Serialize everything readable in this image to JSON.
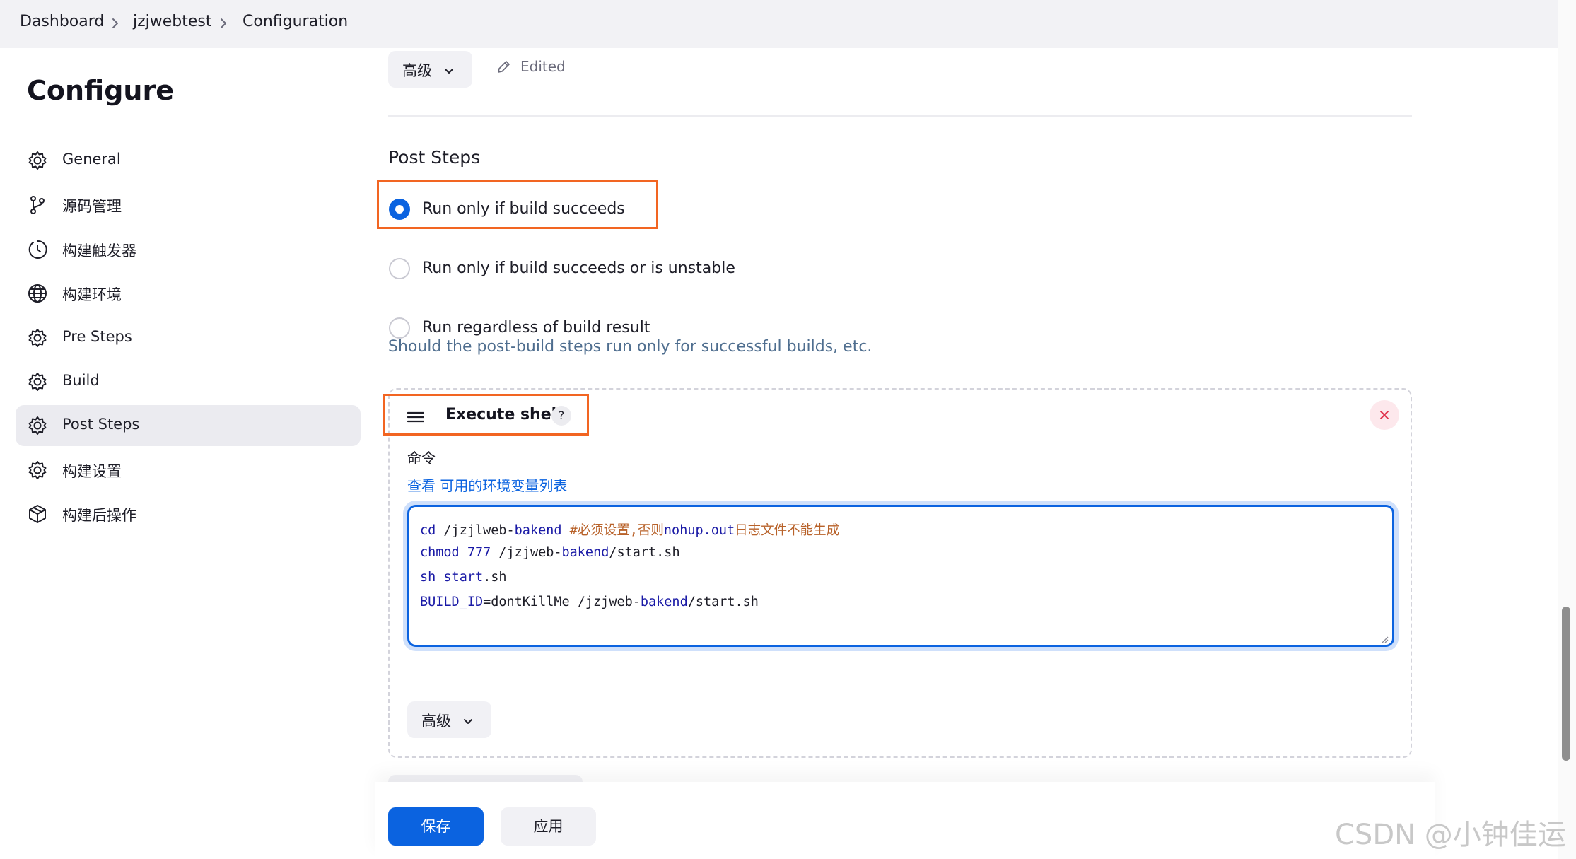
{
  "breadcrumb": {
    "items": [
      "Dashboard",
      "jzjwebtest",
      "Configuration"
    ]
  },
  "sidebar": {
    "title": "Configure",
    "items": [
      {
        "label": "General",
        "icon": "gear-icon"
      },
      {
        "label": "源码管理",
        "icon": "git-branch-icon"
      },
      {
        "label": "构建触发器",
        "icon": "clock-icon"
      },
      {
        "label": "构建环境",
        "icon": "globe-icon"
      },
      {
        "label": "Pre Steps",
        "icon": "gear-icon"
      },
      {
        "label": "Build",
        "icon": "gear-icon"
      },
      {
        "label": "Post Steps",
        "icon": "gear-icon",
        "active": true
      },
      {
        "label": "构建设置",
        "icon": "gear-icon"
      },
      {
        "label": "构建后操作",
        "icon": "package-icon"
      }
    ]
  },
  "main": {
    "advanced_label": "高级",
    "edited_label": "Edited",
    "post_steps": {
      "title": "Post Steps",
      "options": [
        {
          "label": "Run only if build succeeds",
          "checked": true
        },
        {
          "label": "Run only if build succeeds or is unstable",
          "checked": false
        },
        {
          "label": "Run regardless of build result",
          "checked": false
        }
      ],
      "help": "Should the post-build steps run only for successful builds, etc."
    },
    "execute_shell": {
      "title": "Execute shell",
      "help_icon": "?",
      "command_label": "命令",
      "env_prefix": "查看",
      "env_link": "可用的环境变量列表",
      "code_lines": [
        "cd /jzjlweb-bakend #必须设置,否则nohup.out日志文件不能生成",
        "chmod 777 /jzjweb-bakend/start.sh",
        "sh start.sh",
        "BUILD_ID=dontKillMe /jzjweb-bakend/start.sh"
      ],
      "advanced_label": "高级"
    }
  },
  "footer": {
    "save_label": "保存",
    "apply_label": "应用"
  },
  "watermark": "CSDN @小钟佳运",
  "colors": {
    "primary": "#0b63e0",
    "highlight_box": "#f26522",
    "help_text": "#4f6e8f",
    "close_bg": "#fde8ec",
    "close_icon": "#e0344e"
  }
}
